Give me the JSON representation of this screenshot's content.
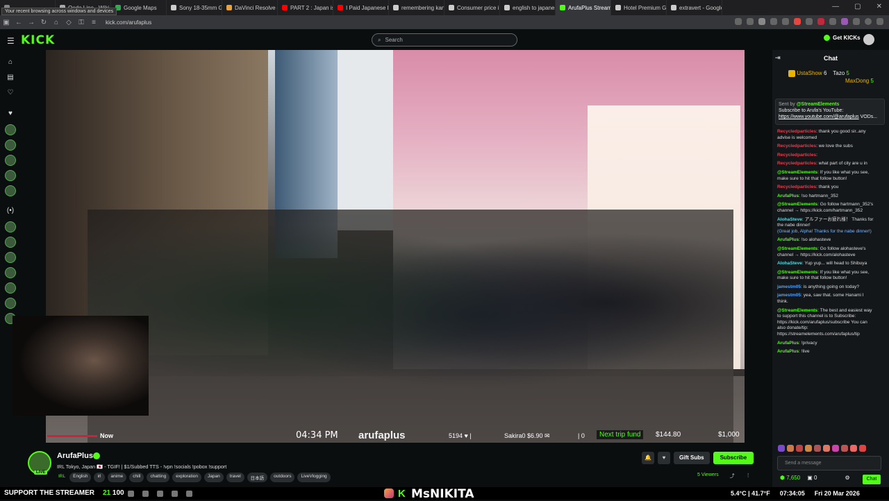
{
  "browser": {
    "tooltip": "Your recent browsing across windows and devices",
    "tabs": [
      {
        "label": "",
        "color": "#888888"
      },
      {
        "label": "Oedo Line - Wiki",
        "color": "#aaaaaa"
      },
      {
        "label": "Google Maps",
        "color": "#34a853"
      },
      {
        "label": "Sony 18-35mm GM L",
        "color": "#cccccc"
      },
      {
        "label": "DaVinci Resolve — Mi",
        "color": "#e8a33d"
      },
      {
        "label": "PART 2 : Japan is curr",
        "color": "#ff0000"
      },
      {
        "label": "I Paid Japanese Peopl",
        "color": "#ff0000"
      },
      {
        "label": "remembering kanji - (",
        "color": "#cccccc"
      },
      {
        "label": "Consumer price inflati",
        "color": "#cccccc"
      },
      {
        "label": "english to japanese -",
        "color": "#cccccc"
      },
      {
        "label": "ArufaPlus Stream",
        "color": "#53fc18",
        "active": true
      },
      {
        "label": "Hotel Premium Green",
        "color": "#cccccc"
      },
      {
        "label": "extravert - Google S",
        "color": "#cccccc"
      }
    ],
    "url": "kick.com/arufaplus"
  },
  "site": {
    "logo": "KICK",
    "search_placeholder": "Search",
    "get_kicks": "Get KICKs"
  },
  "video_overlay": {
    "now": "Now",
    "time": "04:34 PM",
    "handle": "arufaplus",
    "num": "5194 ♥ |",
    "sakira": "Sakira0 $6.90 ✉",
    "zero": "| 0",
    "trip_label": "Next trip fund",
    "trip_amount": "$144.80",
    "trip_goal": "$1,000"
  },
  "chat": {
    "title": "Chat",
    "leaders": {
      "first": "UstaShow",
      "first_count": "6",
      "second": "Tazo",
      "second_count": "5",
      "third": "MaxDong",
      "third_count": "5"
    },
    "pinned": {
      "sent_by": "Sent by",
      "sender": "@StreamElements",
      "text": "Subscribe to Arufa's YouTube:",
      "link": "https://www.youtube.com/@arufaplus",
      "tail": "VODs..."
    },
    "messages": [
      {
        "user": "Recycledparticles",
        "cls": "u-red",
        "text": ": thank you good sir..any advise is welcomed"
      },
      {
        "user": "Recycledparticles",
        "cls": "u-red",
        "text": ": we love the subs"
      },
      {
        "user": "Recycledparticles",
        "cls": "u-red",
        "text": ":"
      },
      {
        "user": "Recycledparticles",
        "cls": "u-red",
        "text": ": what part of city are u in"
      },
      {
        "user": "@StreamElements",
        "cls": "u-green",
        "text": ": If you like what you see, make sure to hit that follow button!"
      },
      {
        "user": "Recycledparticles",
        "cls": "u-red",
        "text": ": thank you"
      },
      {
        "user": "ArufaPlus",
        "cls": "u-green",
        "text": ": !so hartmann_352"
      },
      {
        "user": "@StreamElements",
        "cls": "u-green",
        "text": ": Go follow hartmann_352's channel → https://kick.com/hartmann_352"
      },
      {
        "user": "AlohaSteve",
        "cls": "u-cyan",
        "text": ": アルファーお疲れ様！ Thanks for the nabe dinner!",
        "paren": "(Great job, Alpha! Thanks for the nabe dinner!)"
      },
      {
        "user": "ArufaPlus",
        "cls": "u-green",
        "text": ": !so alohasteve"
      },
      {
        "user": "@StreamElements",
        "cls": "u-green",
        "text": ": Go follow alohasteve's channel → https://kick.com/alohasteve"
      },
      {
        "user": "AlohaSteve",
        "cls": "u-cyan",
        "text": ": Yup yup... will head to Shibuya"
      },
      {
        "user": "@StreamElements",
        "cls": "u-green",
        "text": ": If you like what you see, make sure to hit that follow button!"
      },
      {
        "user": "jamestm05",
        "cls": "u-blue",
        "text": ": is anything going on today?"
      },
      {
        "user": "jamestm05",
        "cls": "u-blue",
        "text": ": yea, saw that. some Hanami I think."
      },
      {
        "user": "@StreamElements",
        "cls": "u-green",
        "text": ": The best and easiest way to support this channel is to Subscribe: https://kick.com/arufaplus/subscribe You can also donate/tip: https://streamelements.com/arufaplus/tip"
      },
      {
        "user": "ArufaPlus",
        "cls": "u-green",
        "text": ": !privacy"
      },
      {
        "user": "ArufaPlus",
        "cls": "u-green",
        "text": ": !live"
      }
    ],
    "send_placeholder": "Send a message",
    "kicks": "7,650",
    "zero": "0",
    "chat_button": "Chat"
  },
  "streamer": {
    "name": "ArufaPlus",
    "live": "LIVE",
    "title": "IRL Tokyo, Japan 🇯🇵 - TGIF! | $1/Subbed TTS - !vpn !socials !pobox !support",
    "tags": [
      "IRL",
      "English",
      "irl",
      "anime",
      "chill",
      "chatting",
      "exploration",
      "Japan",
      "travel",
      "日本語",
      "outdoors",
      "LiveVlogging"
    ],
    "gift_subs": "Gift Subs",
    "subscribe": "Subscribe",
    "viewers": "5 Viewers"
  },
  "taskbar": {
    "support": "SUPPORT THE STREAMER",
    "n1": "21",
    "n2": "100",
    "handle": "MsNIKITA",
    "temp": "5.4°C | 41.7°F",
    "clock": "07:34:05",
    "date": "Fri 20 Mar 2026"
  }
}
